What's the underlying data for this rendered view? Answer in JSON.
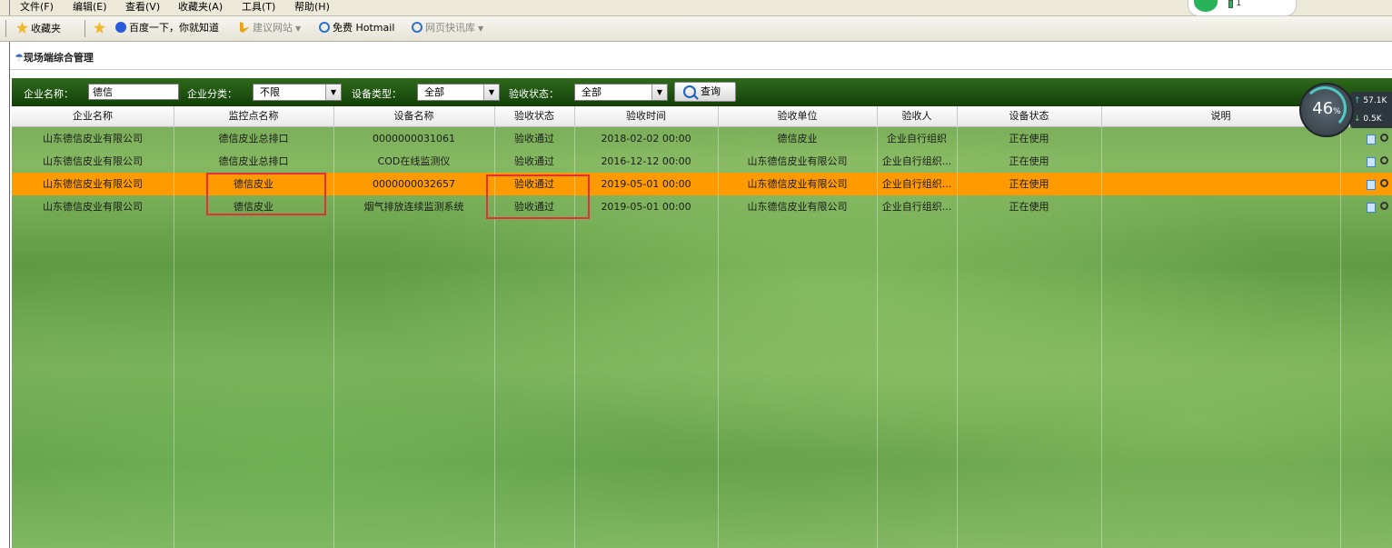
{
  "menubar": {
    "items": [
      "文件(F)",
      "编辑(E)",
      "查看(V)",
      "收藏夹(A)",
      "工具(T)",
      "帮助(H)"
    ]
  },
  "favorites": {
    "main_label": "收藏夹",
    "items": [
      {
        "label": "百度一下，你就知道",
        "icon": "baidu-icon"
      },
      {
        "label": "建议网站",
        "icon": "bing-icon",
        "dropdown": true
      },
      {
        "label": "免费 Hotmail",
        "icon": "ie-icon"
      },
      {
        "label": "网页快讯库",
        "icon": "ie-icon",
        "dropdown": true
      }
    ]
  },
  "page": {
    "title": "现场端综合管理"
  },
  "filters": {
    "company_name_label": "企业名称：",
    "company_name_value": "德信",
    "company_category_label": "企业分类：",
    "company_category_value": "不限",
    "device_type_label": "设备类型：",
    "device_type_value": "全部",
    "acceptance_status_label": "验收状态：",
    "acceptance_status_value": "全部",
    "query_button": "查询"
  },
  "table": {
    "columns": [
      "企业名称",
      "监控点名称",
      "设备名称",
      "验收状态",
      "验收时间",
      "验收单位",
      "验收人",
      "设备状态",
      "说明"
    ],
    "rows": [
      [
        "山东德信皮业有限公司",
        "德信皮业总排口",
        "0000000031061",
        "验收通过",
        "2018-02-02 00:00",
        "德信皮业",
        "企业自行组织",
        "正在使用",
        ""
      ],
      [
        "山东德信皮业有限公司",
        "德信皮业总排口",
        "COD在线监测仪",
        "验收通过",
        "2016-12-12 00:00",
        "山东德信皮业有限公司",
        "企业自行组织...",
        "正在使用",
        ""
      ],
      [
        "山东德信皮业有限公司",
        "德信皮业",
        "0000000032657",
        "验收通过",
        "2019-05-01 00:00",
        "山东德信皮业有限公司",
        "企业自行组织...",
        "正在使用",
        ""
      ],
      [
        "山东德信皮业有限公司",
        "德信皮业",
        "烟气排放连续监测系统",
        "验收通过",
        "2019-05-01 00:00",
        "山东德信皮业有限公司",
        "企业自行组织...",
        "正在使用",
        ""
      ]
    ],
    "selected_row_index": 2,
    "row_actions": [
      "edit-icon",
      "view-icon"
    ]
  },
  "overlay": {
    "cpu_percent": "46",
    "percent_sign": "%",
    "upload_speed": "57.1K",
    "download_speed": "0.5K",
    "widget_count": "1"
  },
  "colors": {
    "toolbar_dark": "#123f07",
    "selected_row": "#ff9a00",
    "highlight_box": "#e5303a"
  }
}
